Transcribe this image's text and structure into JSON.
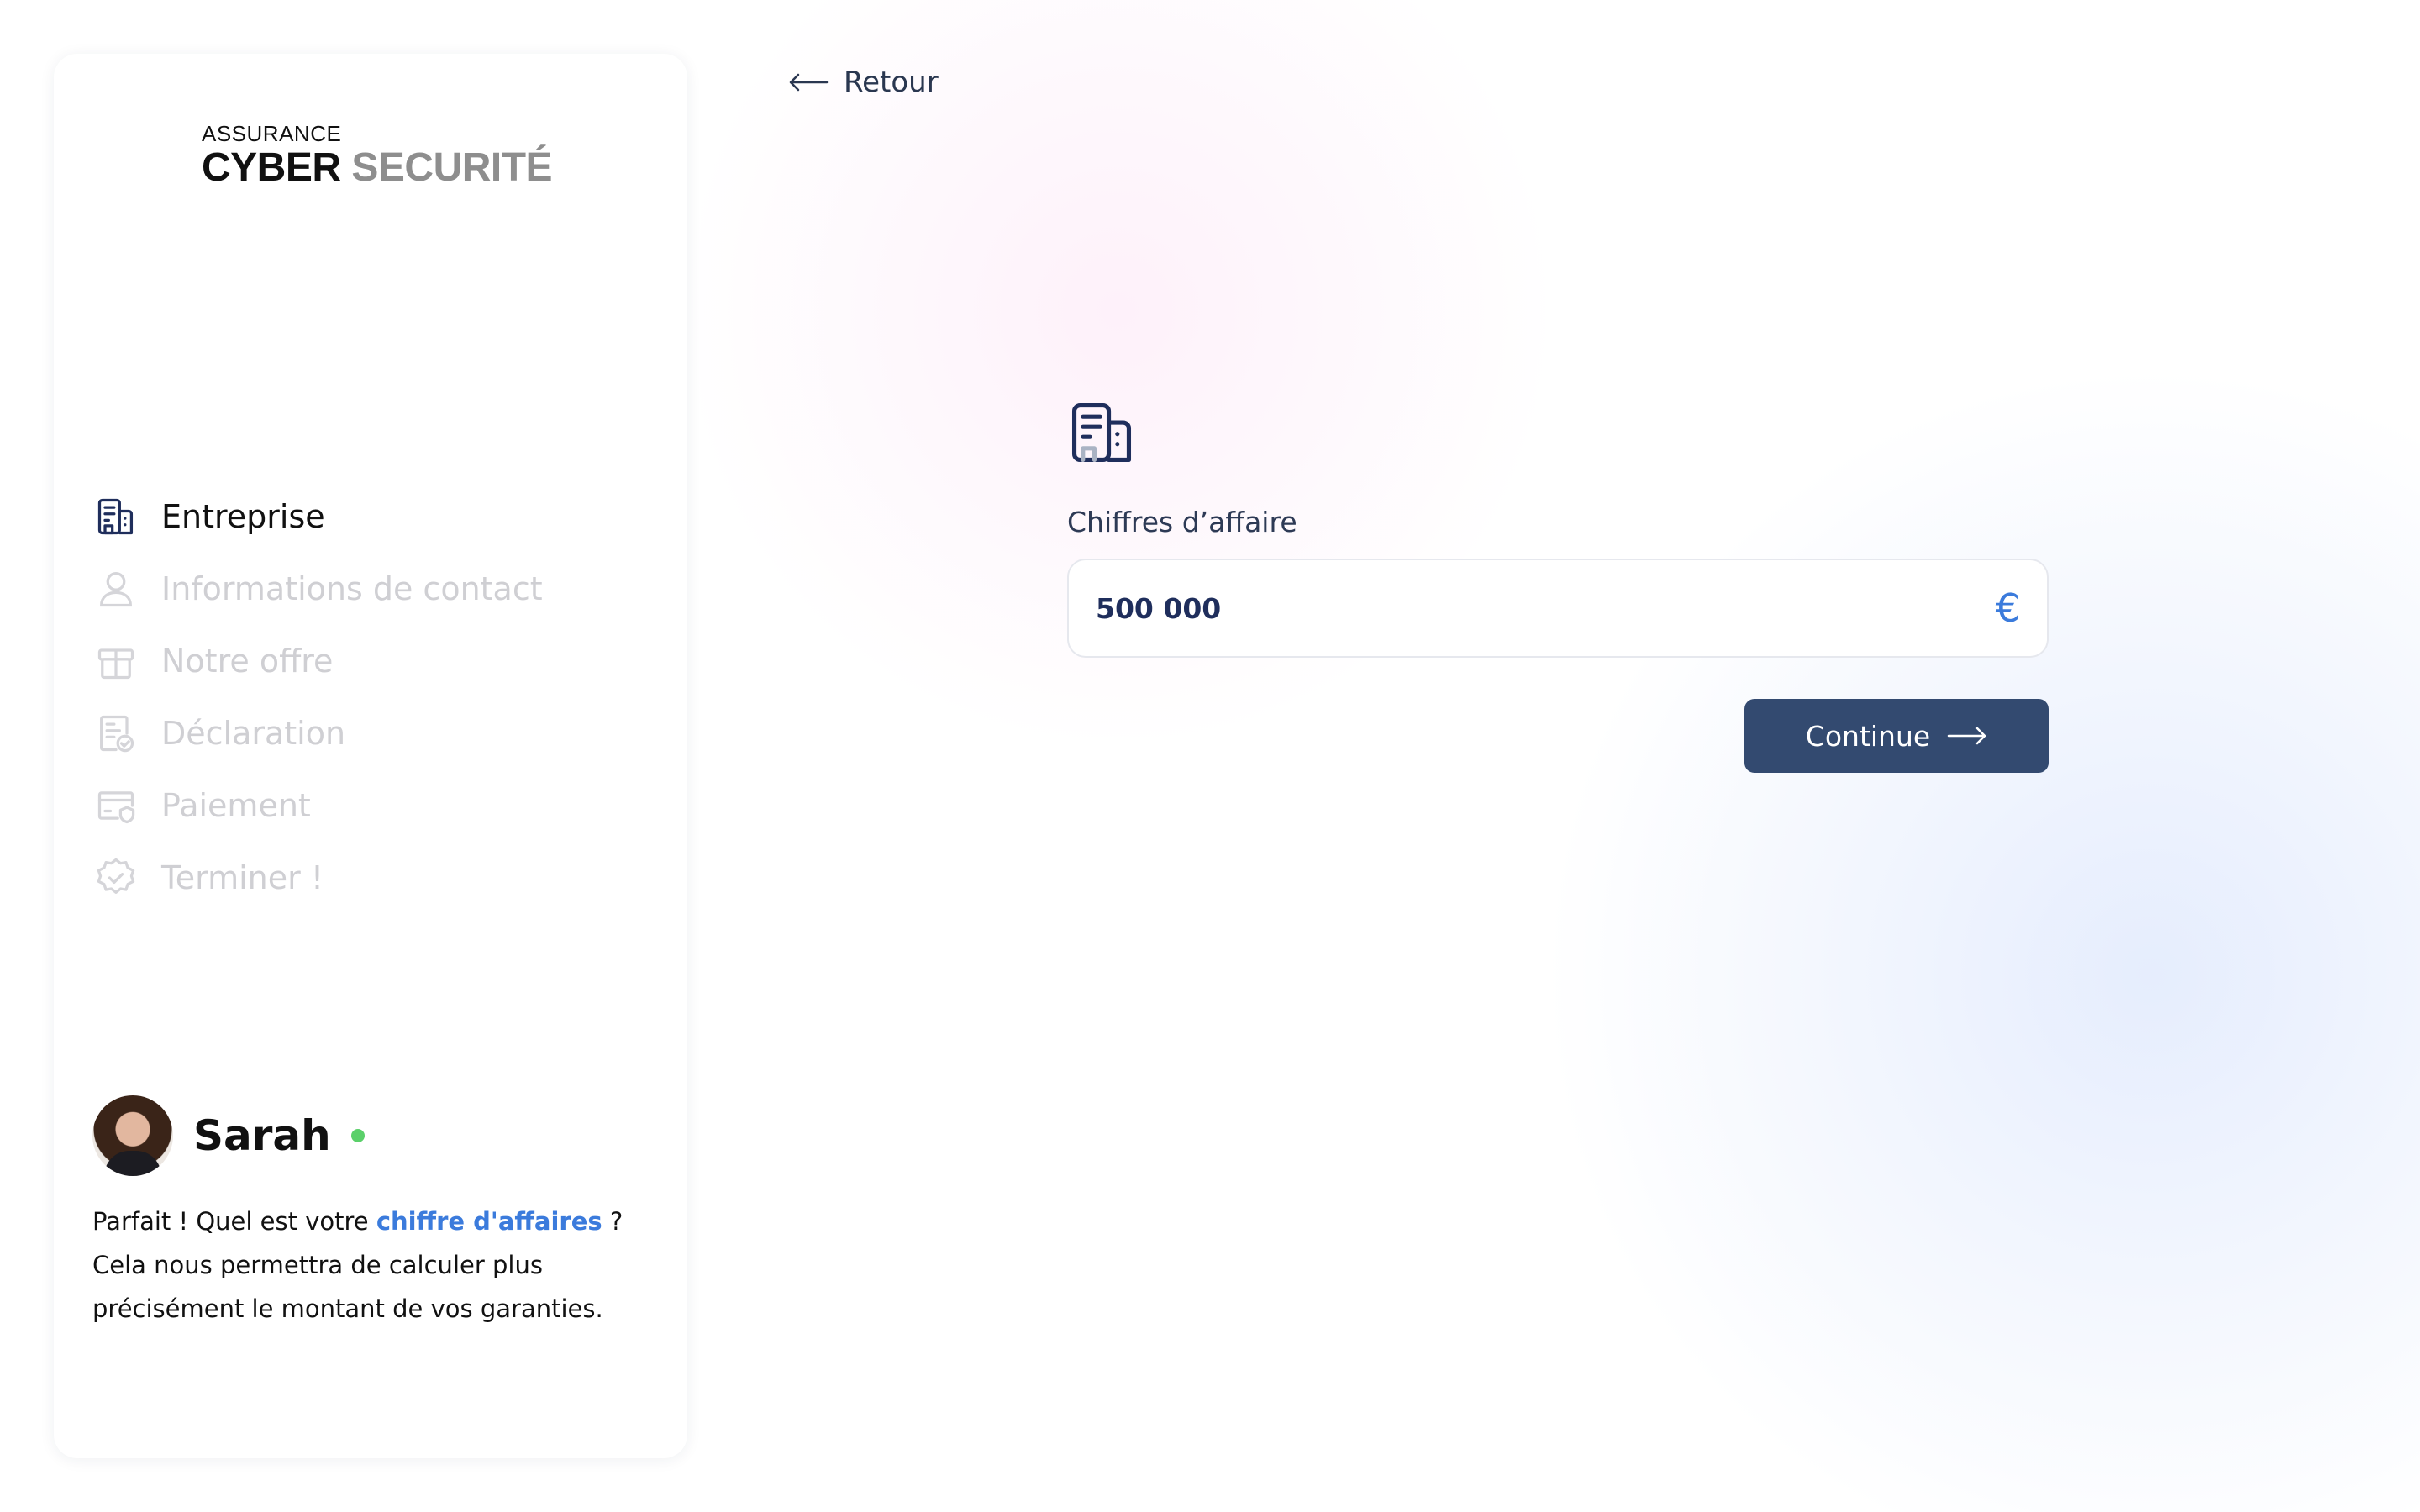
{
  "logo": {
    "top": "ASSURANCE",
    "main_1": "CYBER",
    "main_2": "SECURITÉ"
  },
  "steps": [
    {
      "label": "Entreprise",
      "icon": "building-icon",
      "active": true
    },
    {
      "label": "Informations de contact",
      "icon": "user-icon",
      "active": false
    },
    {
      "label": "Notre offre",
      "icon": "gift-icon",
      "active": false
    },
    {
      "label": "Déclaration",
      "icon": "document-check-icon",
      "active": false
    },
    {
      "label": "Paiement",
      "icon": "credit-card-icon",
      "active": false
    },
    {
      "label": "Terminer !",
      "icon": "badge-check-icon",
      "active": false
    }
  ],
  "assistant": {
    "name": "Sarah",
    "message_before": "Parfait ! Quel est votre ",
    "message_highlight": "chiffre d'affaires",
    "message_after": " ? Cela nous permettra de calculer plus précisément le montant de vos garanties."
  },
  "back": {
    "label": "Retour"
  },
  "form": {
    "label": "Chiffres d’affaire",
    "value": "500 000",
    "currency": "€",
    "continue_label": "Continue"
  },
  "colors": {
    "primary": "#334a70",
    "accent": "#3b7bdc",
    "online": "#5bd06a",
    "inactive": "#cfcfd3"
  }
}
